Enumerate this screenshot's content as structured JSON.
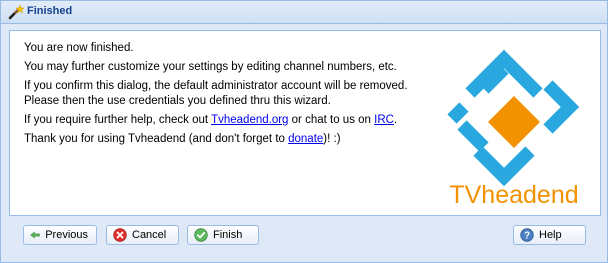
{
  "window": {
    "title": "Finished"
  },
  "message": {
    "line1": "You are now finished.",
    "line2": "You may further customize your settings by editing channel numbers, etc.",
    "line3": "If you confirm this dialog, the default administrator account will be removed.",
    "line4": "Please then the use credentials you defined thru this wizard.",
    "line5_pre": "If you require further help, check out ",
    "line5_link1": "Tvheadend.org",
    "line5_mid": " or chat to us on ",
    "line5_link2": "IRC",
    "line5_post": ".",
    "line6_pre": "Thank you for using Tvheadend (and don't forget to ",
    "line6_link": "donate",
    "line6_post": ")! :)"
  },
  "logo": {
    "text": "TVheadend",
    "blue": "#29a8e0",
    "orange": "#f39200"
  },
  "buttons": {
    "previous": "Previous",
    "cancel": "Cancel",
    "finish": "Finish",
    "help": "Help"
  }
}
